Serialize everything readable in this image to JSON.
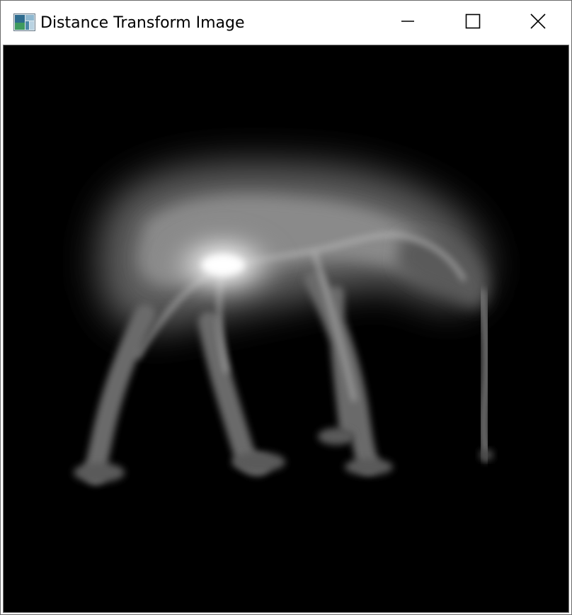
{
  "window": {
    "title": "Distance Transform Image",
    "icon": "app-image-icon",
    "controls": {
      "minimize": "minimize-icon",
      "maximize": "maximize-icon",
      "close": "close-icon"
    }
  },
  "content": {
    "image_kind": "distance-transform",
    "background_color": "#000000",
    "foreground_color": "#ffffff"
  }
}
